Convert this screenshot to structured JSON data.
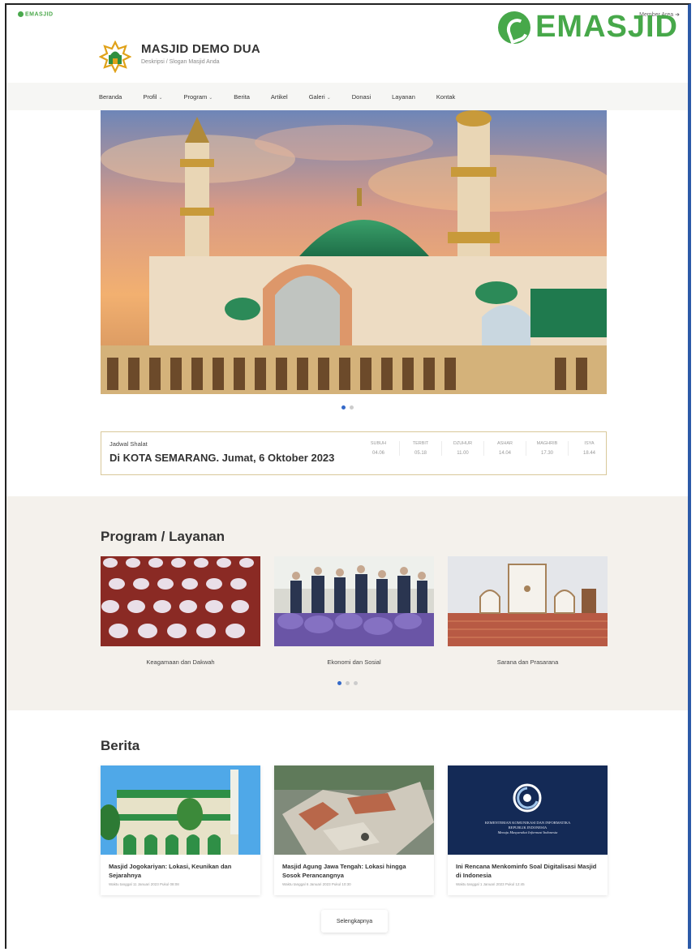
{
  "topbar": {
    "mini_logo": "EMASJID",
    "login": "Member Area"
  },
  "brand": {
    "name": "EMASJID",
    "color": "#47a84a"
  },
  "site": {
    "name": "MASJID DEMO DUA",
    "tagline": "Deskripsi / Slogan Masjid Anda"
  },
  "nav": {
    "items": [
      {
        "label": "Beranda",
        "dropdown": false
      },
      {
        "label": "Profil",
        "dropdown": true
      },
      {
        "label": "Program",
        "dropdown": true
      },
      {
        "label": "Berita",
        "dropdown": false
      },
      {
        "label": "Artikel",
        "dropdown": false
      },
      {
        "label": "Galeri",
        "dropdown": true
      },
      {
        "label": "Donasi",
        "dropdown": false
      },
      {
        "label": "Layanan",
        "dropdown": false
      },
      {
        "label": "Kontak",
        "dropdown": false
      }
    ]
  },
  "prayer": {
    "label": "Jadwal Shalat",
    "title": "Di KOTA SEMARANG. Jumat, 6 Oktober 2023",
    "times": [
      {
        "name": "SUBUH",
        "time": "04.06"
      },
      {
        "name": "TERBIT",
        "time": "05.18"
      },
      {
        "name": "DZUHUR",
        "time": "11.00"
      },
      {
        "name": "ASHAR",
        "time": "14.04"
      },
      {
        "name": "MAGHRIB",
        "time": "17.30"
      },
      {
        "name": "ISYA",
        "time": "18.44"
      }
    ]
  },
  "program": {
    "title": "Program / Layanan",
    "cards": [
      {
        "caption": "Keagamaan dan Dakwah"
      },
      {
        "caption": "Ekonomi dan Sosial"
      },
      {
        "caption": "Sarana dan Prasarana"
      }
    ]
  },
  "berita": {
    "title": "Berita",
    "cards": [
      {
        "title": "Masjid Jogokariyan: Lokasi, Keunikan dan Sejarahnya",
        "meta": "Waktu tanggal 11 Januari 2023 Pukul 08:08"
      },
      {
        "title": "Masjid Agung Jawa Tengah: Lokasi hingga Sosok Perancangnya",
        "meta": "Waktu tanggal 6 Januari 2023 Pukul 10:30"
      },
      {
        "title": "Ini Rencana Menkominfo Soal Digitalisasi Masjid di Indonesia",
        "meta": "Waktu tanggal 1 Januari 2023 Pukul 12:45"
      }
    ],
    "more_label": "Selengkapnya"
  },
  "kominfo_image": {
    "line1": "KEMENTERIAN KOMUNIKASI DAN INFORMATIKA",
    "line2": "REPUBLIK INDONESIA",
    "line3": "Menuju Masyarakat Informasi Indonesia"
  }
}
